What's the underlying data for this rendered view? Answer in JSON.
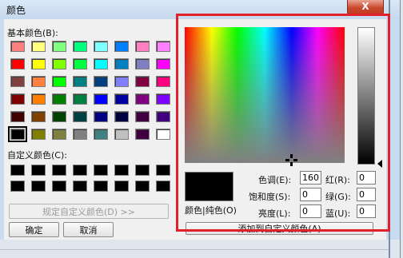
{
  "window": {
    "title": "颜色",
    "close_glyph": "X"
  },
  "basic": {
    "label": "基本颜色(B):",
    "swatches": [
      [
        "#ff8080",
        "#ffff80",
        "#80ff80",
        "#00ff80",
        "#80ffff",
        "#0080ff",
        "#ff80c0",
        "#ff80ff"
      ],
      [
        "#ff0000",
        "#ffff00",
        "#80ff00",
        "#00ff40",
        "#00ffff",
        "#0080c0",
        "#8080c0",
        "#ff00ff"
      ],
      [
        "#804040",
        "#ff8040",
        "#00ff00",
        "#008080",
        "#004080",
        "#8080ff",
        "#800040",
        "#ff0080"
      ],
      [
        "#800000",
        "#ff8000",
        "#008000",
        "#008040",
        "#0000ff",
        "#0000a0",
        "#800080",
        "#8000ff"
      ],
      [
        "#400000",
        "#804000",
        "#004000",
        "#004040",
        "#000080",
        "#000040",
        "#400040",
        "#400080"
      ],
      [
        "#000000",
        "#808000",
        "#808040",
        "#808080",
        "#408080",
        "#c0c0c0",
        "#400040",
        "#ffffff"
      ]
    ],
    "selected": "0,5"
  },
  "custom": {
    "label": "自定义颜色(C):",
    "rows": 2,
    "cols": 8
  },
  "buttons": {
    "define_custom": "规定自定义颜色(D) >>",
    "ok": "确定",
    "cancel": "取消",
    "add_custom": "添加到自定义颜色(A)"
  },
  "picker": {
    "preview_label": "颜色|纯色(O)",
    "hue_label": "色调(E):",
    "hue_value": "160",
    "sat_label": "饱和度(S):",
    "sat_value": "0",
    "lum_label": "亮度(L):",
    "lum_value": "0",
    "red_label": "红(R):",
    "red_value": "0",
    "green_label": "绿(G):",
    "green_value": "0",
    "blue_label": "蓝(U):",
    "blue_value": "0"
  },
  "colors": {
    "highlight_border": "#e0202a",
    "close_button": "#c9472b",
    "dialog_bg": "#f0f0f0"
  }
}
